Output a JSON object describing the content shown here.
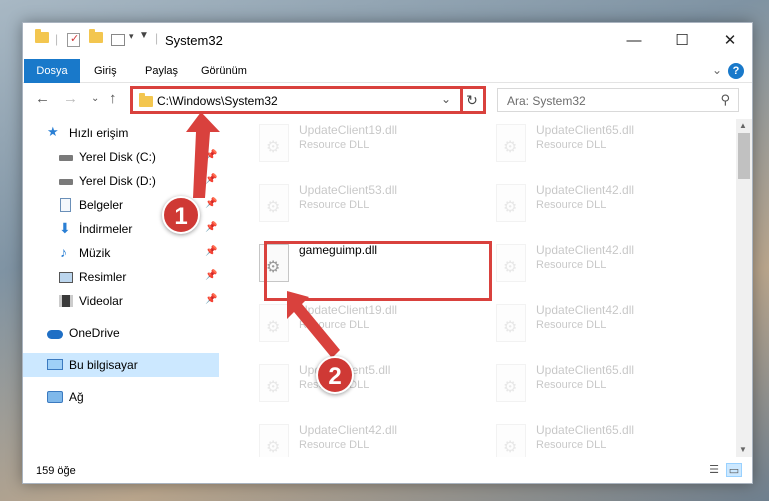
{
  "window": {
    "title": "System32",
    "controls": {
      "minimize": "—",
      "maximize": "☐",
      "close": "✕"
    }
  },
  "ribbon": {
    "tabs": [
      "Dosya",
      "Giriş",
      "Paylaş",
      "Görünüm"
    ],
    "help": "?"
  },
  "navigation": {
    "address_path": "C:\\Windows\\System32",
    "search_placeholder": "Ara: System32",
    "refresh_icon": "↻"
  },
  "sidebar": {
    "items": [
      {
        "label": "Hızlı erişim",
        "icon": "star-icon",
        "pinned": false
      },
      {
        "label": "Yerel Disk (C:)",
        "icon": "drive-icon",
        "pinned": true
      },
      {
        "label": "Yerel Disk (D:)",
        "icon": "drive-icon",
        "pinned": true
      },
      {
        "label": "Belgeler",
        "icon": "documents-icon",
        "pinned": true
      },
      {
        "label": "İndirmeler",
        "icon": "download-icon",
        "pinned": true
      },
      {
        "label": "Müzik",
        "icon": "music-icon",
        "pinned": true
      },
      {
        "label": "Resimler",
        "icon": "pictures-icon",
        "pinned": true
      },
      {
        "label": "Videolar",
        "icon": "video-icon",
        "pinned": true
      },
      {
        "label": "OneDrive",
        "icon": "cloud-icon",
        "pinned": false
      },
      {
        "label": "Bu bilgisayar",
        "icon": "computer-icon",
        "pinned": false,
        "selected": true
      },
      {
        "label": "Ağ",
        "icon": "network-icon",
        "pinned": false
      }
    ]
  },
  "files": [
    {
      "name": "UpdateClient19.dll",
      "desc": "Resource DLL",
      "faded": true
    },
    {
      "name": "UpdateClient65.dll",
      "desc": "Resource DLL",
      "faded": true
    },
    {
      "name": "UpdateClient53.dll",
      "desc": "Resource DLL",
      "faded": true
    },
    {
      "name": "UpdateClient42.dll",
      "desc": "Resource DLL",
      "faded": true
    },
    {
      "name": "gameguimp.dll",
      "desc": "",
      "faded": false,
      "highlighted": true
    },
    {
      "name": "UpdateClient42.dll",
      "desc": "Resource DLL",
      "faded": true
    },
    {
      "name": "UpdateClient19.dll",
      "desc": "Resource DLL",
      "faded": true
    },
    {
      "name": "UpdateClient42.dll",
      "desc": "Resource DLL",
      "faded": true
    },
    {
      "name": "UpdateClient5.dll",
      "desc": "Resource DLL",
      "faded": true
    },
    {
      "name": "UpdateClient65.dll",
      "desc": "Resource DLL",
      "faded": true
    },
    {
      "name": "UpdateClient42.dll",
      "desc": "Resource DLL",
      "faded": true
    },
    {
      "name": "UpdateClient65.dll",
      "desc": "Resource DLL",
      "faded": true
    }
  ],
  "status": {
    "item_count": "159 öğe"
  },
  "annotations": {
    "step1": "1",
    "step2": "2",
    "color": "#cf3935"
  }
}
